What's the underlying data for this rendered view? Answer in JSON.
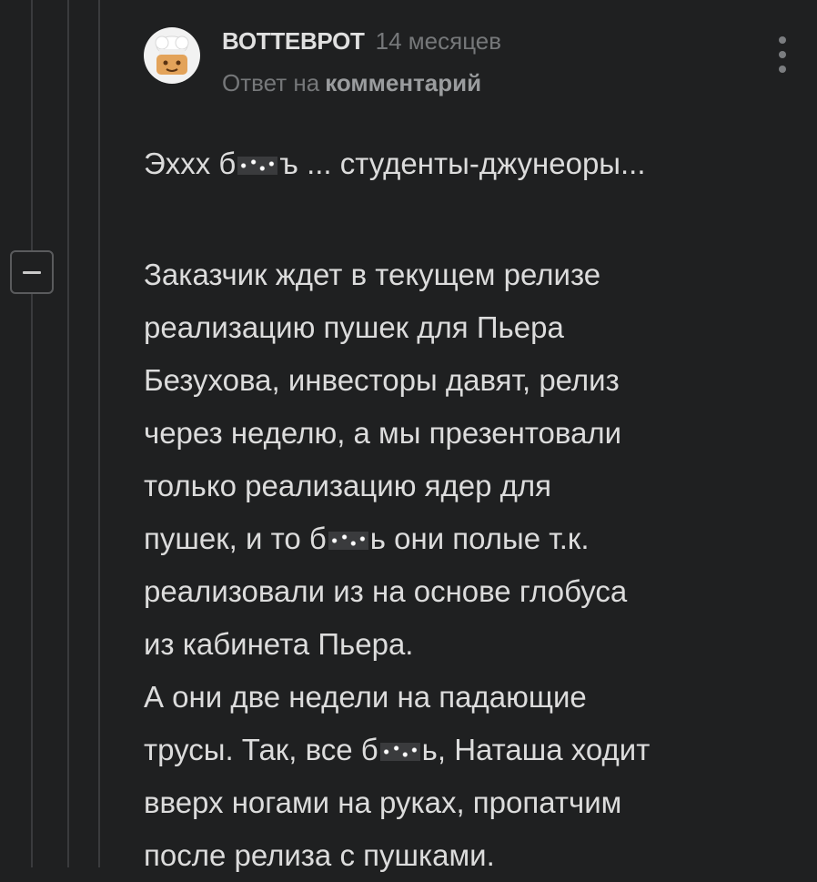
{
  "comment": {
    "author": "ВОТТЕВРОТ",
    "time": "14 месяцев",
    "reply_prefix": "Ответ на",
    "reply_link": "комментарий",
    "avatar_icon": "chef-avatar-icon",
    "more_icon": "more-vertical-icon",
    "collapse_icon": "minus-icon",
    "lines": {
      "l1a": "Эххх б",
      "l1b": "ъ ... студенты-джунеоры...",
      "l2": "Заказчик ждет в текущем релизе",
      "l3": "реализацию пушек для Пьера",
      "l4": "Безухова, инвесторы давят, релиз",
      "l5": "через неделю, а мы презентовали",
      "l6": "только реализацию ядер для",
      "l7a": "пушек, и то б",
      "l7b": "ь они полые т.к.",
      "l8": "реализовали из на основе глобуса",
      "l9": "из кабинета Пьера.",
      "l10": "А они две недели на падающие",
      "l11a": "трусы. Так, все б",
      "l11b": "ь, Наташа ходит",
      "l12": "вверх ногами на руках, пропатчим",
      "l13": "после релиза с пушками."
    }
  },
  "colors": {
    "background": "#1f2021",
    "text": "#dcdcdc",
    "muted": "#76787a",
    "thread_line": "#3a3b3d"
  }
}
